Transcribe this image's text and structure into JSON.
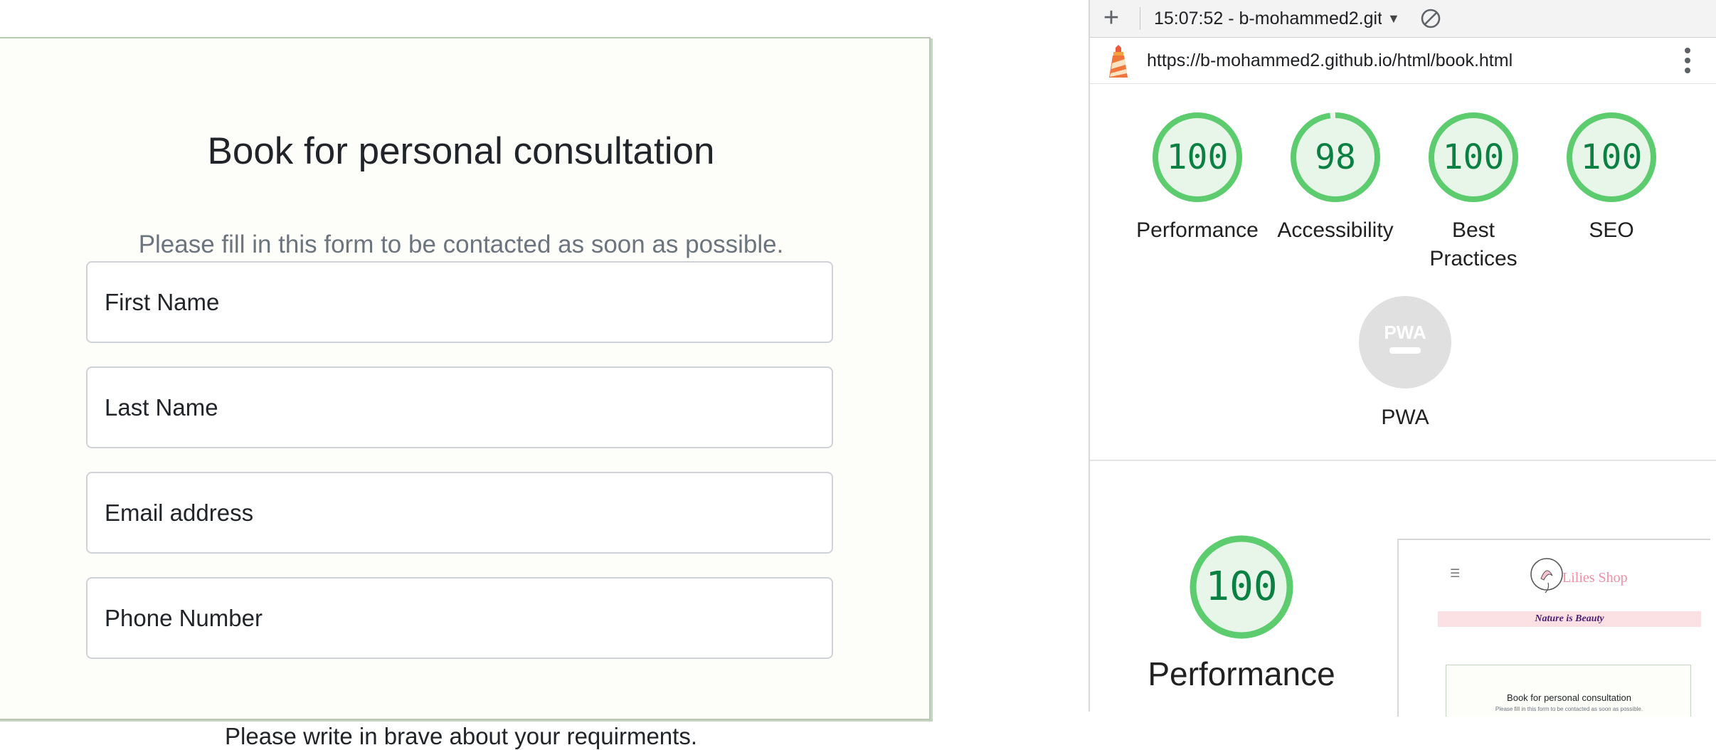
{
  "form": {
    "title": "Book for personal consultation",
    "subtitle": "Please fill in this form to be contacted as soon as possible.",
    "fields": [
      {
        "placeholder": "First Name",
        "value": ""
      },
      {
        "placeholder": "Last Name",
        "value": ""
      },
      {
        "placeholder": "Email address",
        "value": ""
      },
      {
        "placeholder": "Phone Number",
        "value": ""
      }
    ],
    "note": "Please write in brave about your requirments."
  },
  "lighthouse": {
    "report_label": "15:07:52 - b-mohammed2.githu",
    "url": "https://b-mohammed2.github.io/html/book.html",
    "scores": [
      {
        "label": "Performance",
        "score": "100",
        "fraction": 1.0
      },
      {
        "label": "Accessibility",
        "score": "98",
        "fraction": 0.98
      },
      {
        "label": "Best Practices",
        "score": "100",
        "fraction": 1.0
      },
      {
        "label": "SEO",
        "score": "100",
        "fraction": 1.0
      }
    ],
    "pwa": {
      "label": "PWA",
      "badge_text": "PWA"
    },
    "performance_detail": {
      "score": "100",
      "label": "Performance",
      "fraction": 1.0
    },
    "thumbnail": {
      "shop_name": "Lilies Shop",
      "tagline": "Nature is Beauty",
      "title": "Book for personal consultation",
      "subtitle": "Please fill in this form to be contacted as soon as possible."
    },
    "colors": {
      "pass": "#0b8043",
      "ring": "#5ccc6e",
      "ring_bg": "#e8f5e9"
    }
  }
}
